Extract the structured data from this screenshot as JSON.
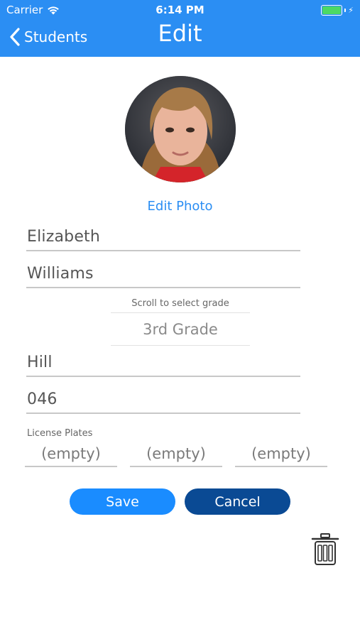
{
  "status_bar": {
    "carrier": "Carrier",
    "time": "6:14 PM",
    "wifi_icon": "wifi-icon",
    "battery_icon": "battery-icon"
  },
  "nav": {
    "back_label": "Students",
    "title": "Edit"
  },
  "photo": {
    "edit_label": "Edit Photo"
  },
  "form": {
    "first_name": "Elizabeth",
    "last_name": "Williams",
    "grade_hint": "Scroll to select grade",
    "grade_value": "3rd Grade",
    "teacher": "Hill",
    "room": "046",
    "plates_label": "License Plates",
    "plates": [
      "(empty)",
      "(empty)",
      "(empty)"
    ]
  },
  "actions": {
    "save_label": "Save",
    "cancel_label": "Cancel",
    "delete_icon": "trash-icon"
  },
  "colors": {
    "header": "#2b8ef3",
    "save": "#1a8cff",
    "cancel": "#0a4a94",
    "link": "#2b8ef3"
  }
}
